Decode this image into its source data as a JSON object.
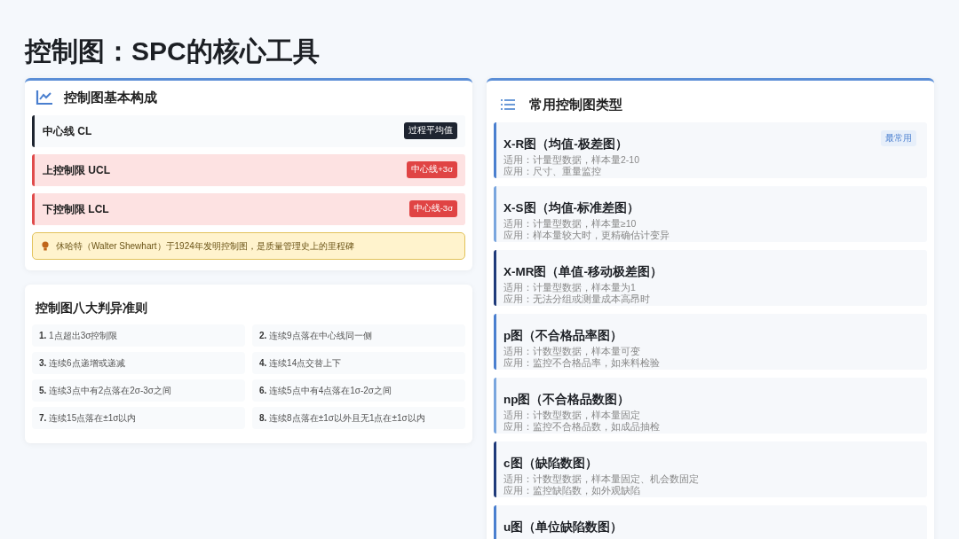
{
  "title": "控制图：SPC的核心工具",
  "components": {
    "heading": "控制图基本构成",
    "items": [
      {
        "kind": "center",
        "label": "中心线 CL",
        "badge": "过程平均值"
      },
      {
        "kind": "limit",
        "label": "上控制限 UCL",
        "badge": "中心线+3σ"
      },
      {
        "kind": "limit",
        "label": "下控制限 LCL",
        "badge": "中心线-3σ"
      }
    ],
    "note": "休哈特（Walter Shewhart）于1924年发明控制图，是质量管理史上的里程碑"
  },
  "rules": {
    "heading": "控制图八大判异准则",
    "items": [
      "**1.** 1点超出3σ控制限",
      "**2.** 连续9点落在中心线同一侧",
      "**3.** 连续6点递增或递减",
      "**4.** 连续14点交替上下",
      "**5.** 连续3点中有2点落在2σ-3σ之间",
      "**6.** 连续5点中有4点落在1σ-2σ之间",
      "**7.** 连续15点落在±1σ以内",
      "**8.** 连续8点落在±1σ以外且无1点在±1σ以内"
    ]
  },
  "types": {
    "heading": "常用控制图类型",
    "items": [
      {
        "title": "X-R图（均值-极差图）",
        "color": "#4a7fcf",
        "badge": "最常用",
        "lines": [
          "适用：计量型数据，样本量2-10",
          "应用：尺寸、重量监控"
        ]
      },
      {
        "title": "X-S图（均值-标准差图）",
        "color": "#7aa6de",
        "lines": [
          "适用：计量型数据，样本量≥10",
          "应用：样本量较大时，更精确估计变异"
        ]
      },
      {
        "title": "X-MR图（单值-移动极差图）",
        "color": "#1f3a7a",
        "lines": [
          "适用：计量型数据，样本量为1",
          "应用：无法分组或测量成本高昂时"
        ]
      },
      {
        "title": "p图（不合格品率图）",
        "color": "#4a7fcf",
        "lines": [
          "适用：计数型数据，样本量可变",
          "应用：监控不合格品率，如来料检验"
        ]
      },
      {
        "title": "np图（不合格品数图）",
        "color": "#7aa6de",
        "lines": [
          "适用：计数型数据，样本量固定",
          "应用：监控不合格品数，如成品抽检"
        ]
      },
      {
        "title": "c图（缺陷数图）",
        "color": "#1f3a7a",
        "lines": [
          "适用：计数型数据，样本量固定、机会数固定",
          "应用：监控缺陷数，如外观缺陷"
        ]
      },
      {
        "title": "u图（单位缺陷数图）",
        "color": "#4a7fcf"
      }
    ]
  }
}
